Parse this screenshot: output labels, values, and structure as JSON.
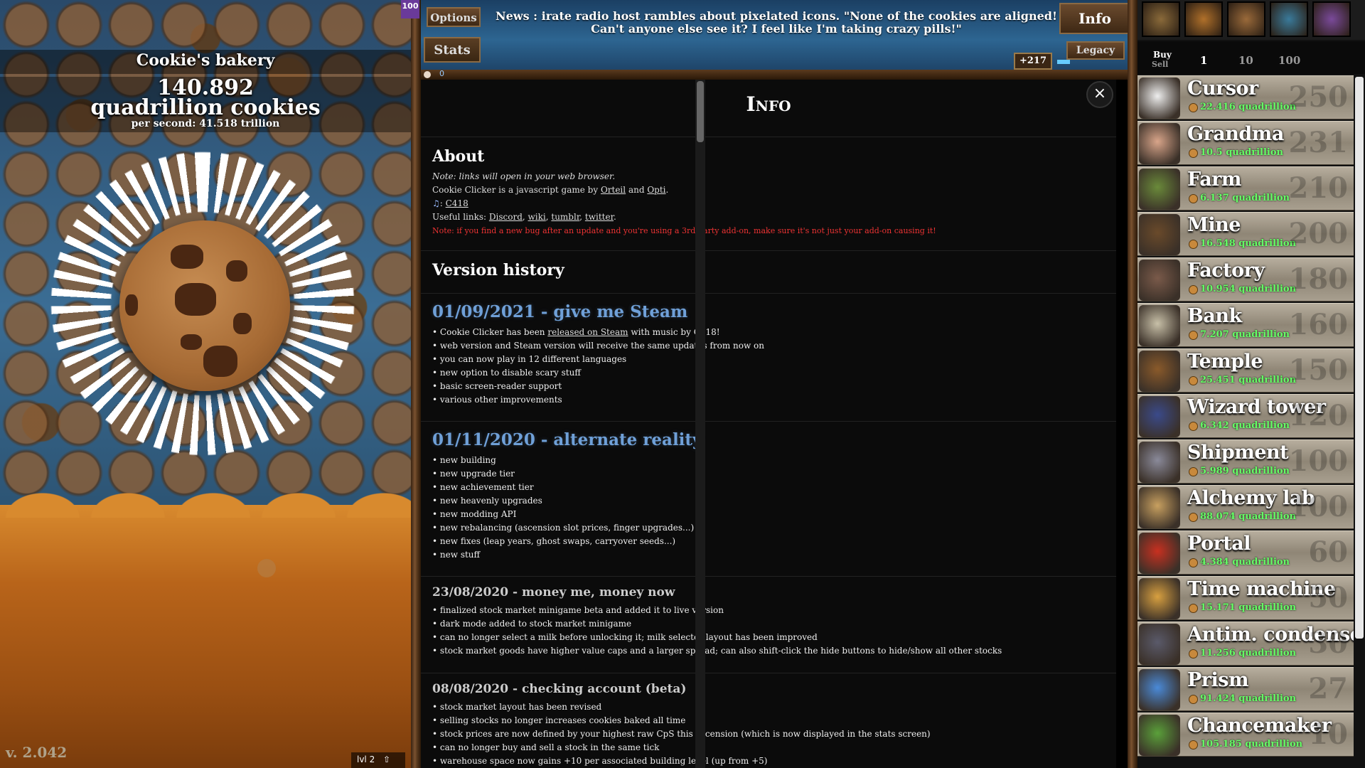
{
  "left": {
    "bakery_name": "Cookie's bakery",
    "cookie_count": "140.892",
    "cookie_unit": "quadrillion cookies",
    "per_second": "per second: 41.518 trillion",
    "version": "v. 2.042",
    "level_label": "lvl 2",
    "level_flag": "100"
  },
  "topbar": {
    "options_label": "Options",
    "stats_label": "Stats",
    "info_label": "Info",
    "legacy_label": "Legacy",
    "news": "News : irate radio host rambles about pixelated icons. \"None of the cookies are aligned! Can't anyone else see it? I feel like I'm taking crazy pills!\"",
    "prestige": "+217",
    "milk_count": "0"
  },
  "info": {
    "title": "Info",
    "close": "×",
    "about": {
      "title": "About",
      "note": "Note: links will open in your web browser.",
      "line1_pre": "Cookie Clicker is a javascript game by ",
      "orteil": "Orteil",
      "and": " and ",
      "opti": "Opti",
      "period": ".",
      "music_prefix": ": ",
      "c418": "C418",
      "useful_pre": "Useful links: ",
      "discord": "Discord",
      "wiki": "wiki",
      "tumblr": "tumblr",
      "twitter": "twitter",
      "comma": ", ",
      "bug_note": "Note: if you find a new bug after an update and you're using a 3rd-party add-on, make sure it's not just your add-on causing it!"
    },
    "version_history_title": "Version history",
    "versions": [
      {
        "title": "01/09/2021 - give me Steam",
        "notes_pre": "Cookie Clicker has been ",
        "notes_link": "released on Steam",
        "notes_post": " with music by C418!",
        "notes": [
          "web version and Steam version will receive the same updates from now on",
          "you can now play in 12 different languages",
          "new option to disable scary stuff",
          "basic screen-reader support",
          "various other improvements"
        ]
      },
      {
        "title": "01/11/2020 - alternate reality",
        "notes": [
          "new building",
          "new upgrade tier",
          "new achievement tier",
          "new heavenly upgrades",
          "new modding API",
          "new rebalancing (ascension slot prices, finger upgrades...)",
          "new fixes (leap years, ghost swaps, carryover seeds...)",
          "new stuff"
        ]
      },
      {
        "title": "23/08/2020 - money me, money now",
        "notes": [
          "finalized stock market minigame beta and added it to live version",
          "dark mode added to stock market minigame",
          "can no longer select a milk before unlocking it; milk selector layout has been improved",
          "stock market goods have higher value caps and a larger spread; can also shift-click the hide buttons to hide/show all other stocks"
        ]
      },
      {
        "title": "08/08/2020 - checking account (beta)",
        "notes": [
          "stock market layout has been revised",
          "selling stocks no longer increases cookies baked all time",
          "stock prices are now defined by your highest raw CpS this ascension (which is now displayed in the stats screen)",
          "can no longer buy and sell a stock in the same tick",
          "warehouse space now gains +10 per associated building level (up from +5)"
        ]
      }
    ]
  },
  "store": {
    "buy_label": "Buy",
    "sell_label": "Sell",
    "amounts": [
      "1",
      "10",
      "100"
    ],
    "upgrade_colors": [
      "#8a6a3a",
      "#b0702a",
      "#9a6a3a",
      "#3a7a9a",
      "#7a4a9a"
    ],
    "buildings": [
      {
        "name": "Cursor",
        "price": "22.416 quadrillion",
        "count": "250",
        "icon": "cursor-icon",
        "color": "#eeeeee"
      },
      {
        "name": "Grandma",
        "price": "10.5 quadrillion",
        "count": "231",
        "icon": "grandma-icon",
        "color": "#d9a58a"
      },
      {
        "name": "Farm",
        "price": "6.137 quadrillion",
        "count": "210",
        "icon": "farm-icon",
        "color": "#6a8a3a"
      },
      {
        "name": "Mine",
        "price": "16.548 quadrillion",
        "count": "200",
        "icon": "mine-icon",
        "color": "#6a4a2a"
      },
      {
        "name": "Factory",
        "price": "10.954 quadrillion",
        "count": "180",
        "icon": "factory-icon",
        "color": "#7a5a4a"
      },
      {
        "name": "Bank",
        "price": "7.207 quadrillion",
        "count": "160",
        "icon": "bank-icon",
        "color": "#c8c0a8"
      },
      {
        "name": "Temple",
        "price": "25.451 quadrillion",
        "count": "150",
        "icon": "temple-icon",
        "color": "#8a5a2a"
      },
      {
        "name": "Wizard tower",
        "price": "6.342 quadrillion",
        "count": "120",
        "icon": "wizard-tower-icon",
        "color": "#3a4a8a"
      },
      {
        "name": "Shipment",
        "price": "5.989 quadrillion",
        "count": "100",
        "icon": "shipment-icon",
        "color": "#8a8a9a"
      },
      {
        "name": "Alchemy lab",
        "price": "88.074 quadrillion",
        "count": "100",
        "icon": "alchemy-lab-icon",
        "color": "#c8a060"
      },
      {
        "name": "Portal",
        "price": "4.384 quadrillion",
        "count": "60",
        "icon": "portal-icon",
        "color": "#c83020"
      },
      {
        "name": "Time machine",
        "price": "15.171 quadrillion",
        "count": "50",
        "icon": "time-machine-icon",
        "color": "#d8a040"
      },
      {
        "name": "Antim. condenser",
        "price": "11.256 quadrillion",
        "count": "30",
        "icon": "antimatter-condenser-icon",
        "color": "#5a5a6a"
      },
      {
        "name": "Prism",
        "price": "91.424 quadrillion",
        "count": "27",
        "icon": "prism-icon",
        "color": "#4a8ad8"
      },
      {
        "name": "Chancemaker",
        "price": "105.185 quadrillion",
        "count": "10",
        "icon": "chancemaker-icon",
        "color": "#5aa03a"
      }
    ]
  }
}
